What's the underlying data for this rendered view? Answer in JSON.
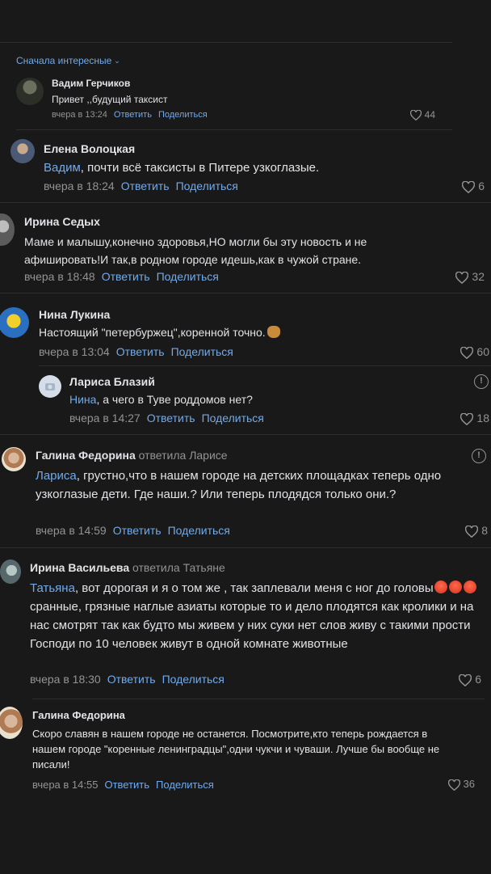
{
  "header": {
    "sort_label": "Сначала интересные"
  },
  "labels": {
    "reply": "Ответить",
    "share": "Поделиться"
  },
  "comments": [
    {
      "name": "Вадим Герчиков",
      "text": "Привет ,,будущий таксист",
      "time": "вчера в 13:24",
      "likes": "44"
    },
    {
      "name": "Елена Волоцкая",
      "mention": "Вадим",
      "text": ", почти всё таксисты в Питере узкоглазые.",
      "time": "вчера в 18:24",
      "likes": "6"
    },
    {
      "name": "Ирина Седых",
      "text": "Маме и малышу,конечно здоровья,НО могли бы эту новость и не афишировать!И так,в родном городе идешь,как в чужой стране.",
      "time": "вчера в 18:48",
      "likes": "32"
    },
    {
      "name": "Нина Лукина",
      "text": "Настоящий \"петербуржец\",коренной точно.",
      "time": "вчера в 13:04",
      "likes": "60"
    },
    {
      "name": "Лариса Блазий",
      "mention": "Нина",
      "text": ", а чего в Туве роддомов нет?",
      "time": "вчера в 14:27",
      "likes": "18"
    },
    {
      "name": "Галина Федорина",
      "reply_to": "ответила Ларисе",
      "mention": "Лариса",
      "text": ", грустно,что в нашем городе на детских площадках теперь одно узкоглазые дети. Где наши.? Или теперь плодядся только они.?",
      "time": "вчера в 14:59",
      "likes": "8"
    },
    {
      "name": "Ирина Васильева",
      "reply_to": "ответила Татьяне",
      "mention": "Татьяна",
      "text_a": ", вот дорогая и я о том же , так заплевали меня с ног до головы",
      "text_b": "сранные, грязные наглые азиаты которые то и дело плодятся как кролики и на нас смотрят так как будто мы живем у них суки нет слов живу с такими прости Господи по 10 человек живут в одной комнате животные",
      "time": "вчера в 18:30",
      "likes": "6"
    },
    {
      "name": "Галина Федорина",
      "text": "Скоро славян в нашем городе не останется. Посмотрите,кто теперь рождается в нашем городе \"коренные ленинградцы\",одни чукчи и чуваши. Лучше бы вообще не писали!",
      "time": "вчера в 14:55",
      "likes": "36"
    }
  ],
  "icons": {
    "like": "heart-icon",
    "report": "exclamation-circle-icon",
    "sort": "chevron-down-icon"
  },
  "colors": {
    "background": "#19191a",
    "link": "#71aaeb",
    "muted": "#939393",
    "text": "#e1e3e6"
  }
}
